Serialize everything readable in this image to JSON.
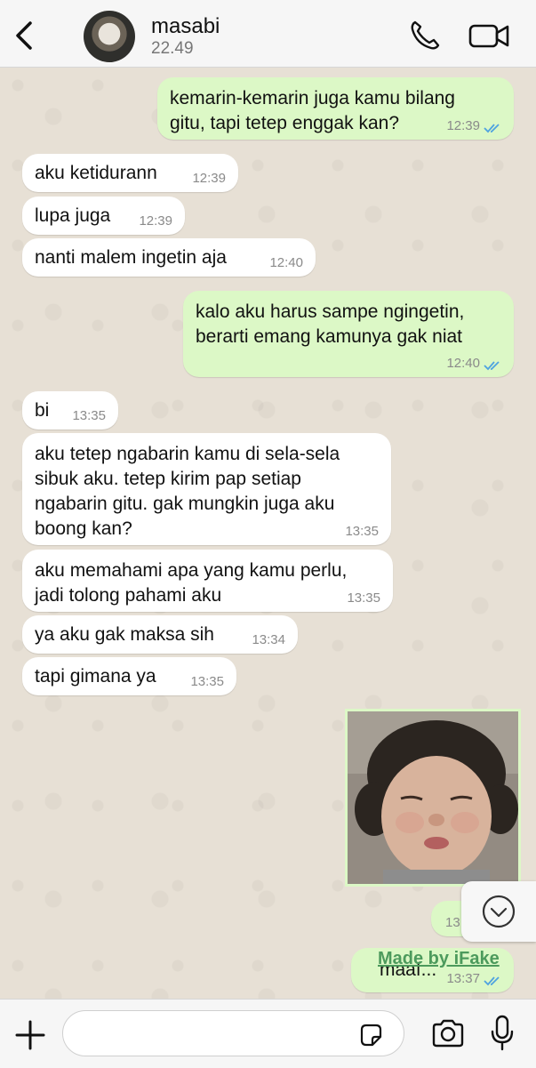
{
  "header": {
    "contact_name": "masabi",
    "subtitle": "22.49",
    "icons": {
      "back": "chevron-left-icon",
      "call": "phone-icon",
      "video": "video-camera-icon"
    }
  },
  "messages": [
    {
      "dir": "out",
      "text": "kemarin-kemarin juga kamu bilang\ngitu, tapi tetep enggak kan?",
      "time": "12:39",
      "status": "read"
    },
    {
      "dir": "in",
      "text": "aku ketidurann",
      "time": "12:39"
    },
    {
      "dir": "in",
      "text": "lupa juga",
      "time": "12:39"
    },
    {
      "dir": "in",
      "text": "nanti malem ingetin aja",
      "time": "12:40"
    },
    {
      "dir": "out",
      "text": "kalo aku harus sampe ngingetin,\nberarti emang kamunya gak niat",
      "time": "12:40",
      "status": "read"
    },
    {
      "dir": "in",
      "text": "bi",
      "time": "13:35"
    },
    {
      "dir": "in",
      "text": "aku tetep ngabarin kamu di sela-sela\nsibuk aku. tetep kirim pap setiap\nngabarin gitu. gak mungkin juga aku\nboong kan?",
      "time": "13:35"
    },
    {
      "dir": "in",
      "text": "aku memahami apa yang kamu perlu,\njadi tolong pahami aku",
      "time": "13:35"
    },
    {
      "dir": "in",
      "text": "ya aku gak maksa sih",
      "time": "13:34"
    },
    {
      "dir": "in",
      "text": "tapi gimana ya",
      "time": "13:35"
    },
    {
      "dir": "out",
      "type": "photo",
      "icon": "baby-photo"
    },
    {
      "dir": "out",
      "text": "",
      "time": "13:",
      "status": "read"
    },
    {
      "dir": "out",
      "text": "maaf...",
      "time": "13:37",
      "status": "read"
    }
  ],
  "watermark": "Made by iFake",
  "composer": {
    "placeholder": "",
    "icons": {
      "add": "plus-icon",
      "sticker": "sticker-icon",
      "camera": "camera-icon",
      "mic": "microphone-icon"
    }
  },
  "scroll_button_icon": "chevron-down-circle-icon",
  "colors": {
    "outgoing_bubble": "#dcf8c6",
    "incoming_bubble": "#ffffff",
    "read_ticks": "#4fa3e0",
    "chat_bg": "#e7e0d5",
    "header_bg": "#f6f6f6"
  }
}
